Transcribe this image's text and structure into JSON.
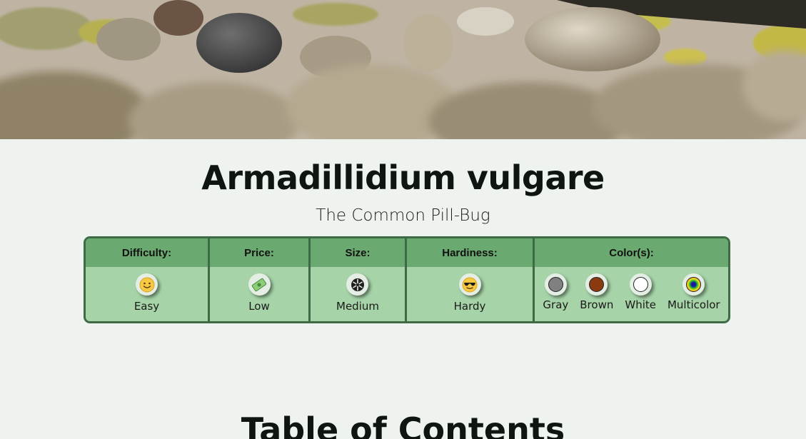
{
  "page": {
    "title": "Armadillidium vulgare",
    "subtitle": "The Common Pill-Bug"
  },
  "stats": {
    "difficulty": {
      "header": "Difficulty:",
      "items": [
        {
          "label": "Easy",
          "icon": "smiley-face-icon"
        }
      ]
    },
    "price": {
      "header": "Price:",
      "items": [
        {
          "label": "Low",
          "icon": "money-icon"
        }
      ]
    },
    "size": {
      "header": "Size:",
      "items": [
        {
          "label": "Medium",
          "icon": "size-medium-icon"
        }
      ]
    },
    "hardiness": {
      "header": "Hardiness:",
      "items": [
        {
          "label": "Hardy",
          "icon": "sunglasses-face-icon"
        }
      ]
    },
    "colors": {
      "header": "Color(s):",
      "items": [
        {
          "label": "Gray",
          "color": "#808080"
        },
        {
          "label": "Brown",
          "color": "#8b3a0f"
        },
        {
          "label": "White",
          "color": "#ffffff"
        },
        {
          "label": "Multicolor",
          "color": "rainbow"
        }
      ]
    }
  },
  "toc": {
    "title": "Table of Contents"
  },
  "theme": {
    "background": "#eff3f0",
    "table_border": "#3e6b45",
    "header_bg": "#6aa96f",
    "body_bg": "#a6d4a8"
  }
}
